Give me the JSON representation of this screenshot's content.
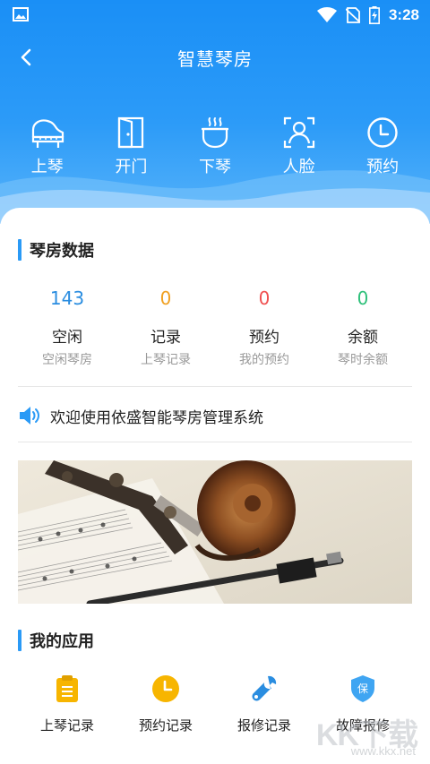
{
  "status_bar": {
    "time": "3:28"
  },
  "header": {
    "title": "智慧琴房"
  },
  "quick_actions": [
    {
      "label": "上琴",
      "icon": "piano-icon"
    },
    {
      "label": "开门",
      "icon": "door-icon"
    },
    {
      "label": "下琴",
      "icon": "cup-icon"
    },
    {
      "label": "人脸",
      "icon": "face-scan-icon"
    },
    {
      "label": "预约",
      "icon": "clock-icon"
    }
  ],
  "room_data": {
    "title": "琴房数据",
    "stats": [
      {
        "value": "143",
        "label": "空闲",
        "sub": "空闲琴房",
        "color": "#2a8de0"
      },
      {
        "value": "0",
        "label": "记录",
        "sub": "上琴记录",
        "color": "#f0a020"
      },
      {
        "value": "0",
        "label": "预约",
        "sub": "我的预约",
        "color": "#f05050"
      },
      {
        "value": "0",
        "label": "余额",
        "sub": "琴时余额",
        "color": "#2ec07a"
      }
    ]
  },
  "notice": {
    "text": "欢迎使用依盛智能琴房管理系统"
  },
  "my_apps": {
    "title": "我的应用",
    "items": [
      {
        "label": "上琴记录",
        "icon": "clipboard-icon"
      },
      {
        "label": "预约记录",
        "icon": "clock-icon"
      },
      {
        "label": "报修记录",
        "icon": "wrench-icon"
      },
      {
        "label": "故障报修",
        "icon": "shield-icon"
      }
    ]
  },
  "watermark": {
    "big": "KK下载",
    "small": "www.kkx.net"
  },
  "colors": {
    "primary": "#2a9af6",
    "header_bg": "#1a8ff6"
  }
}
